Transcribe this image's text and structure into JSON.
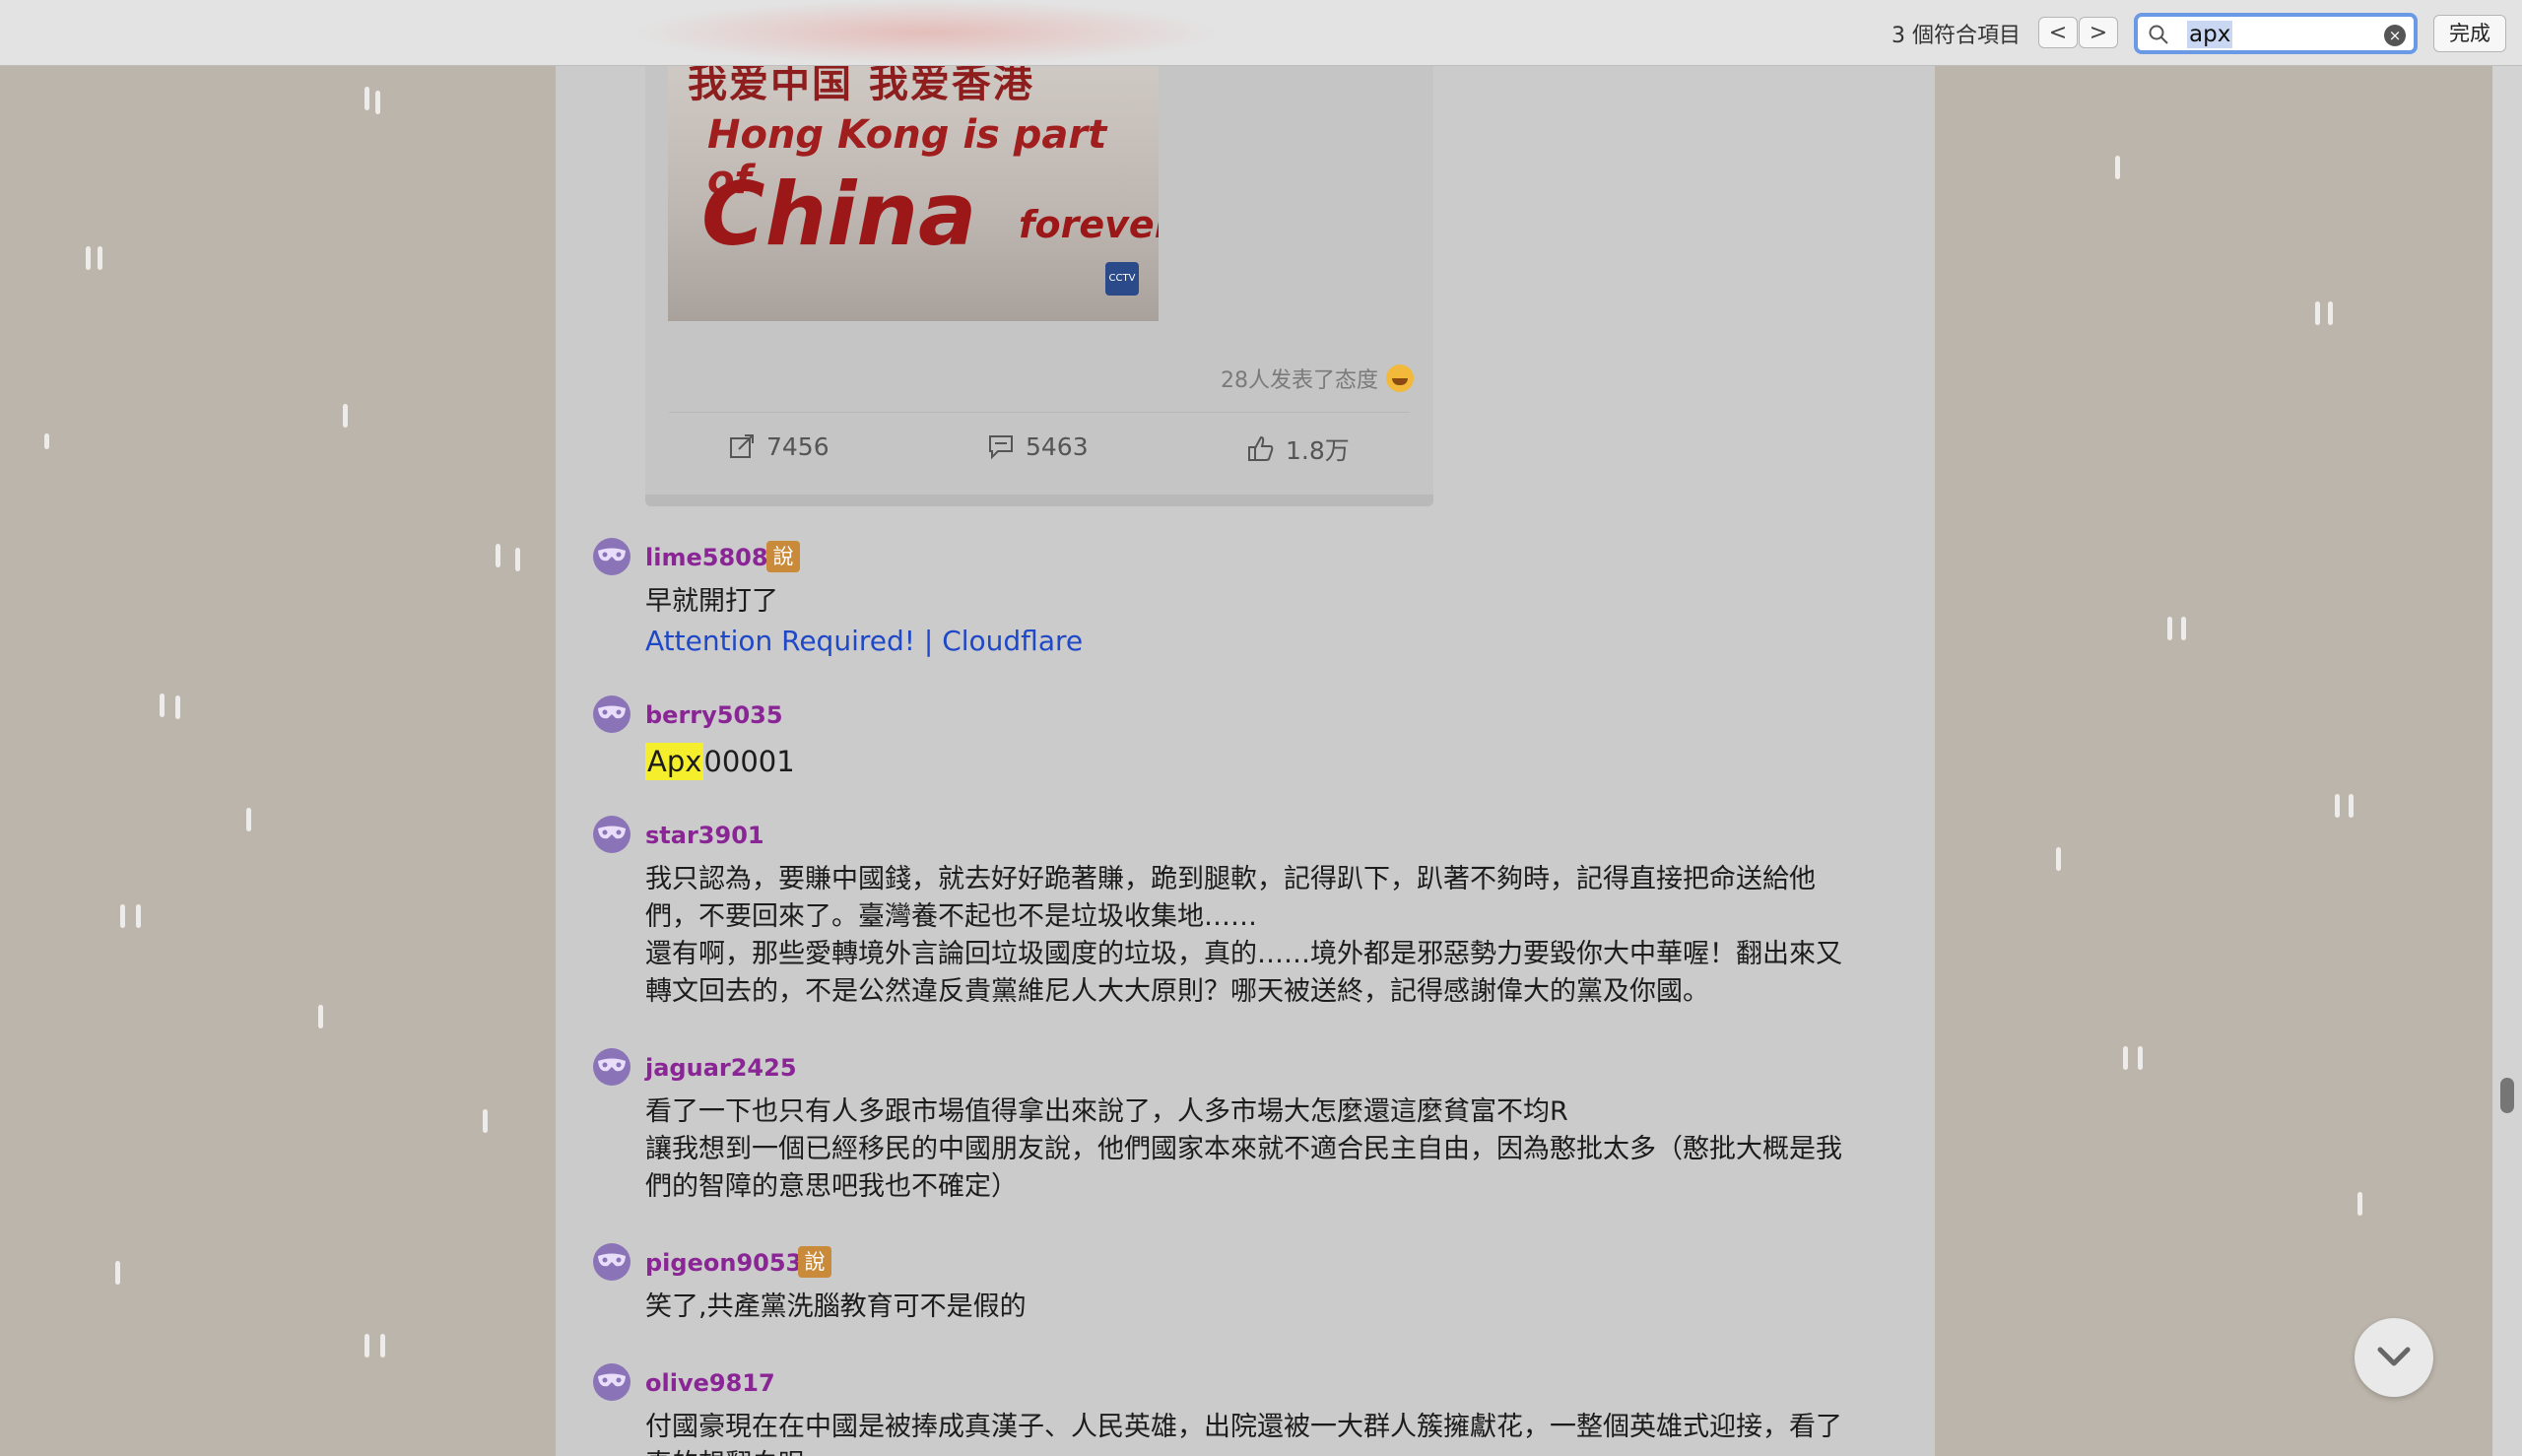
{
  "find_bar": {
    "match_count": "3 個符合項目",
    "prev_label": "<",
    "next_label": ">",
    "query": "apx",
    "done_label": "完成"
  },
  "post": {
    "image": {
      "line1": "我爱中国 我爱香港",
      "line2": "Hong Kong is part of",
      "line3": "China",
      "line4": "forever"
    },
    "reaction_text": "28人发表了态度",
    "reposts": "7456",
    "comments": "5463",
    "likes": "1.8万"
  },
  "comments": [
    {
      "user": "lime5808",
      "badge": "說",
      "lines": [
        "早就開打了"
      ],
      "link": "Attention Required! | Cloudflare"
    },
    {
      "user": "berry5035",
      "highlight": "Apx",
      "rest": "00001"
    },
    {
      "user": "star3901",
      "lines": [
        "我只認為，要賺中國錢，就去好好跪著賺，跪到腿軟，記得趴下，趴著不夠時，記得直接把命送給他",
        "們，不要回來了。臺灣養不起也不是垃圾收集地……",
        "還有啊，那些愛轉境外言論回垃圾國度的垃圾，真的……境外都是邪惡勢力要毀你大中華喔！翻出來又",
        "轉文回去的，不是公然違反貴黨維尼人大大原則？哪天被送終，記得感謝偉大的黨及你國。"
      ]
    },
    {
      "user": "jaguar2425",
      "lines": [
        "看了一下也只有人多跟市場值得拿出來說了，人多市場大怎麼還這麼貧富不均R",
        "讓我想到一個已經移民的中國朋友說，他們國家本來就不適合民主自由，因為憨批太多（憨批大概是我",
        "們的智障的意思吧我也不確定）"
      ]
    },
    {
      "user": "pigeon9053",
      "badge": "說",
      "lines": [
        "笑了,共產黨洗腦教育可不是假的"
      ]
    },
    {
      "user": "olive9817",
      "lines": [
        "付國豪現在在中國是被捧成真漢子、人民英雄，出院還被一大群人簇擁獻花，一整個英雄式迎接，看了",
        "真的想翻白眼"
      ]
    }
  ]
}
